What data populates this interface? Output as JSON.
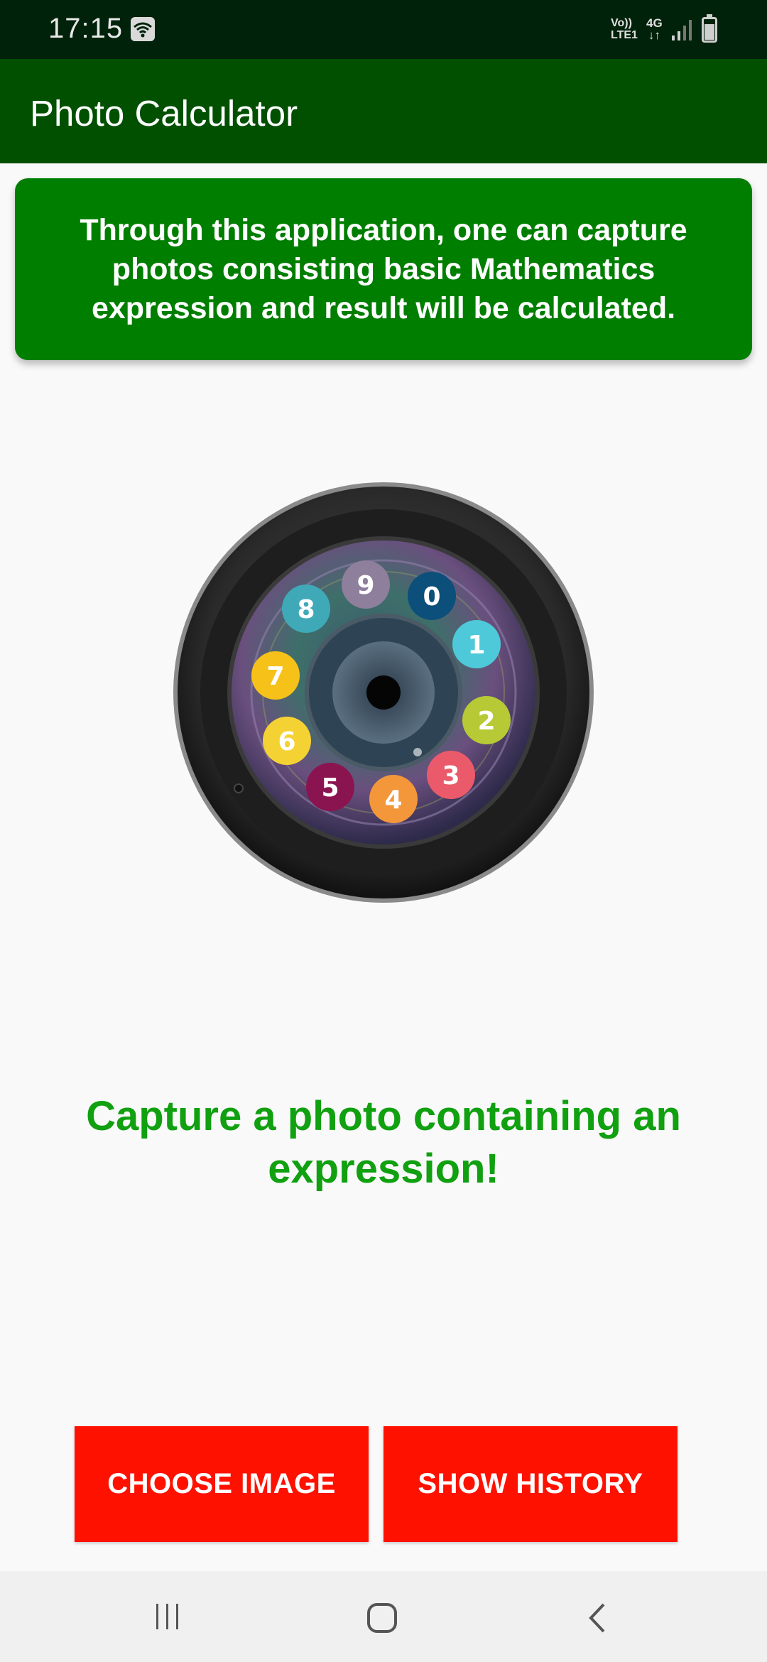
{
  "status_bar": {
    "time": "17:15",
    "network_line1": "Vo))",
    "network_line2": "LTE1",
    "data_type": "4G",
    "data_arrows": "↓↑"
  },
  "app_bar": {
    "title": "Photo Calculator"
  },
  "info_card": {
    "text": "Through this application, one can capture photos consisting basic Mathematics expression and result will be calculated."
  },
  "lens_image": {
    "digits": [
      "0",
      "1",
      "2",
      "3",
      "4",
      "5",
      "6",
      "7",
      "8",
      "9"
    ],
    "digit_colors": [
      "#0b4f7a",
      "#4ec9d9",
      "#b7c934",
      "#ea5a6a",
      "#f3973a",
      "#8a1450",
      "#f5d234",
      "#f6c21a",
      "#3fa9b8",
      "#8e7f9c"
    ]
  },
  "main": {
    "capture_prompt": "Capture a photo containing an expression!"
  },
  "buttons": {
    "choose_image": "CHOOSE IMAGE",
    "show_history": "SHOW HISTORY"
  },
  "colors": {
    "app_bar": "#005000",
    "info_card": "#007e00",
    "prompt_text": "#10a010",
    "button": "#ff1100"
  }
}
